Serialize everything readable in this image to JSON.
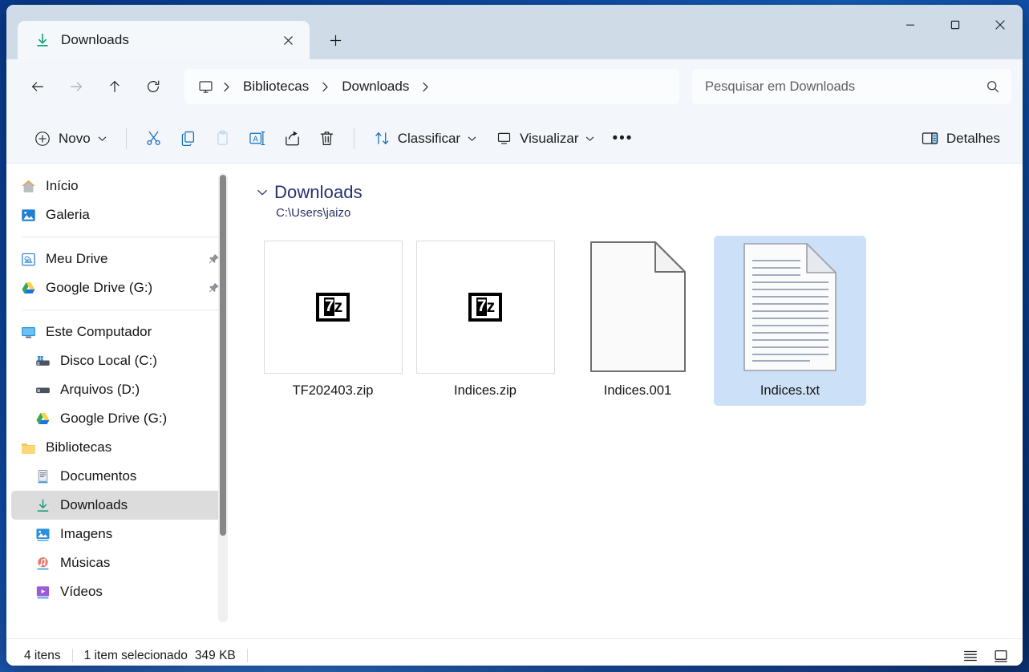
{
  "window": {
    "tab": {
      "title": "Downloads",
      "icon": "download-icon"
    },
    "new_tab_label": "+",
    "controls": {
      "minimize": "minimize-icon",
      "maximize": "maximize-icon",
      "close": "close-icon"
    }
  },
  "nav": {
    "back": "back-arrow-icon",
    "forward": "forward-arrow-icon",
    "up": "up-arrow-icon",
    "refresh": "refresh-icon",
    "breadcrumb": {
      "root_icon": "monitor-icon",
      "items": [
        "Bibliotecas",
        "Downloads"
      ]
    }
  },
  "search": {
    "placeholder": "Pesquisar em Downloads",
    "value": "",
    "icon": "search-icon"
  },
  "toolbar": {
    "new_label": "Novo",
    "cut_icon": "scissors-icon",
    "copy_icon": "copy-icon",
    "paste_icon": "paste-icon",
    "rename_icon": "rename-icon",
    "share_icon": "share-icon",
    "delete_icon": "trash-icon",
    "sort_label": "Classificar",
    "view_label": "Visualizar",
    "more_label": "•••",
    "details_label": "Detalhes"
  },
  "sidebar": {
    "groups": [
      {
        "items": [
          {
            "label": "Início",
            "icon": "home-icon",
            "pinned": false,
            "selected": false,
            "indent": false
          },
          {
            "label": "Galeria",
            "icon": "gallery-icon",
            "pinned": false,
            "selected": false,
            "indent": false
          }
        ]
      },
      {
        "items": [
          {
            "label": "Meu Drive",
            "icon": "onedrive-icon",
            "pinned": true,
            "selected": false,
            "indent": false
          },
          {
            "label": "Google Drive (G:)",
            "icon": "google-drive-icon",
            "pinned": true,
            "selected": false,
            "indent": false
          }
        ]
      },
      {
        "items": [
          {
            "label": "Este Computador",
            "icon": "this-pc-icon",
            "pinned": false,
            "selected": false,
            "indent": false
          },
          {
            "label": "Disco Local (C:)",
            "icon": "system-drive-icon",
            "pinned": false,
            "selected": false,
            "indent": true
          },
          {
            "label": "Arquivos (D:)",
            "icon": "drive-icon",
            "pinned": false,
            "selected": false,
            "indent": true
          },
          {
            "label": "Google Drive (G:)",
            "icon": "google-drive-icon",
            "pinned": false,
            "selected": false,
            "indent": true
          },
          {
            "label": "Bibliotecas",
            "icon": "folder-icon",
            "pinned": false,
            "selected": false,
            "indent": false
          },
          {
            "label": "Documentos",
            "icon": "documents-icon",
            "pinned": false,
            "selected": false,
            "indent": true
          },
          {
            "label": "Downloads",
            "icon": "downloads-icon",
            "pinned": false,
            "selected": true,
            "indent": true
          },
          {
            "label": "Imagens",
            "icon": "pictures-icon",
            "pinned": false,
            "selected": false,
            "indent": true
          },
          {
            "label": "Músicas",
            "icon": "music-icon",
            "pinned": false,
            "selected": false,
            "indent": true
          },
          {
            "label": "Vídeos",
            "icon": "videos-icon",
            "pinned": false,
            "selected": false,
            "indent": true
          }
        ]
      }
    ]
  },
  "filepane": {
    "group_title": "Downloads",
    "group_path": "C:\\Users\\jaizo",
    "files": [
      {
        "name": "TF202403.zip",
        "icon": "sevenzip-icon",
        "selected": false
      },
      {
        "name": "Indices.zip",
        "icon": "sevenzip-icon",
        "selected": false
      },
      {
        "name": "Indices.001",
        "icon": "blank-document-icon",
        "selected": false
      },
      {
        "name": "Indices.txt",
        "icon": "text-document-icon",
        "selected": true
      }
    ]
  },
  "statusbar": {
    "item_count": "4 itens",
    "selection": "1 item selecionado",
    "size": "349 KB",
    "details_view_icon": "list-view-icon",
    "large_icons_view_icon": "large-icons-view-icon"
  },
  "colors": {
    "titlebar": "#cfdbe7",
    "chrome": "#f3f6fa",
    "selection": "#cce1f7",
    "sidebar_selected": "#dcdcdc",
    "group_header": "#253170"
  }
}
